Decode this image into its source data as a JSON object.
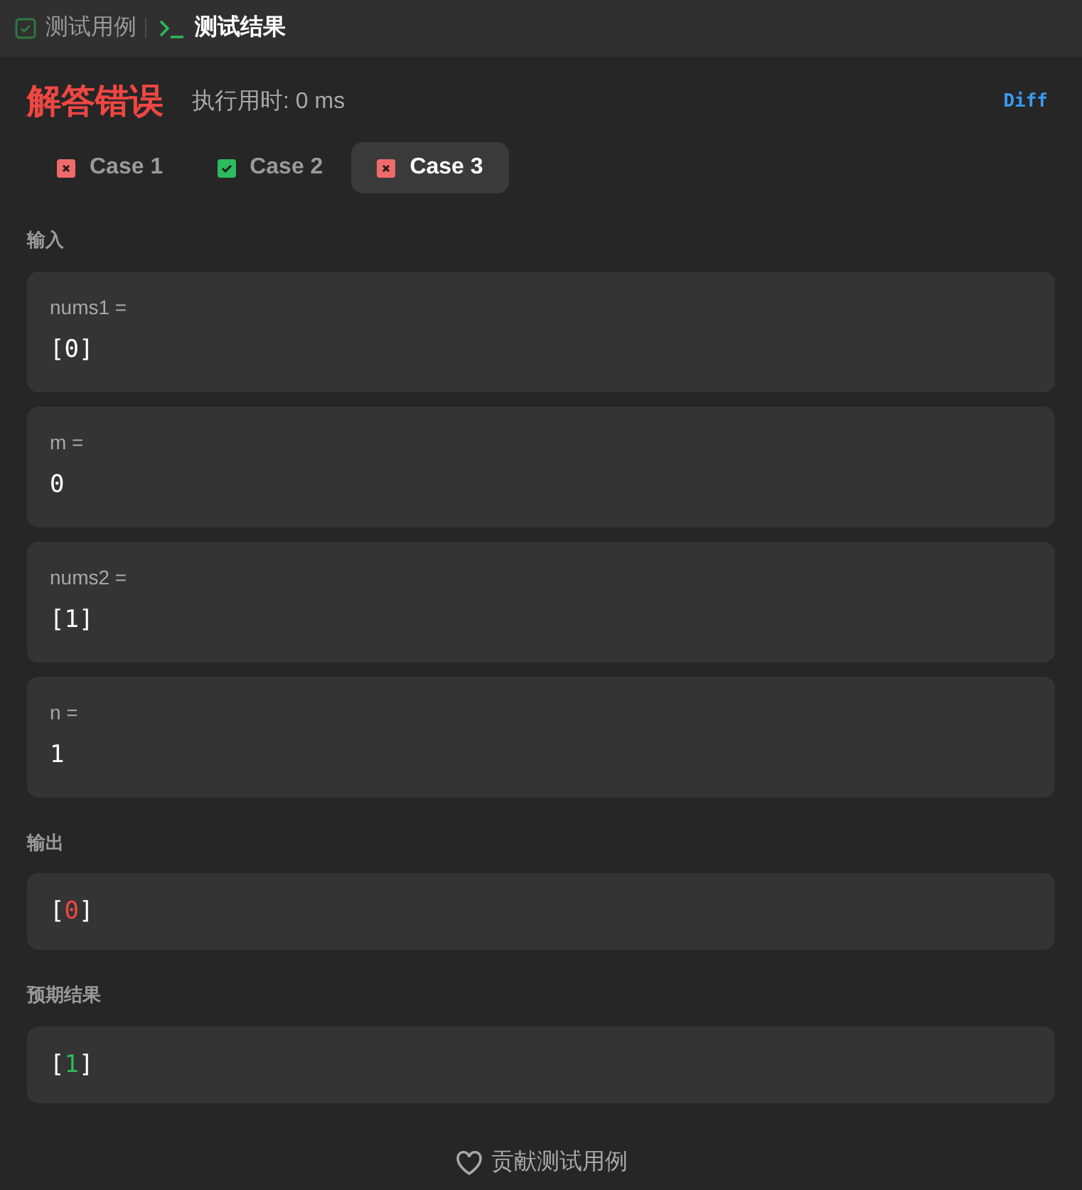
{
  "top_tabs": [
    {
      "label": "测试用例",
      "kind": "testcase",
      "selected": false
    },
    {
      "label": "测试结果",
      "kind": "result",
      "selected": true
    }
  ],
  "verdict": "解答错误",
  "runtime": "执行用时: 0 ms",
  "diff_button": "Diff",
  "cases": [
    {
      "label": "Case 1",
      "passed": false,
      "selected": false
    },
    {
      "label": "Case 2",
      "passed": true,
      "selected": false
    },
    {
      "label": "Case 3",
      "passed": false,
      "selected": true
    }
  ],
  "input_heading": "输入",
  "inputs": [
    {
      "name": "nums1 =",
      "value": "[0]"
    },
    {
      "name": "m =",
      "value": "0"
    },
    {
      "name": "nums2 =",
      "value": "[1]"
    },
    {
      "name": "n =",
      "value": "1"
    }
  ],
  "output_heading": "输出",
  "output": {
    "open": "[",
    "value": "0",
    "close": "]",
    "kind": "wrong"
  },
  "expected_heading": "预期结果",
  "expected": {
    "open": "[",
    "value": "1",
    "close": "]",
    "kind": "correct"
  },
  "contribute_button": "贡献测试用例"
}
